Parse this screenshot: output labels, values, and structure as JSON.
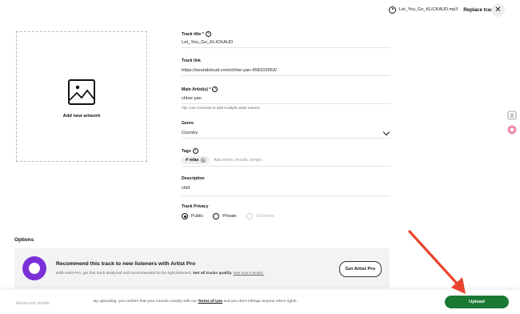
{
  "header": {
    "file_name": "Let_You_Go_KLICKAUD.mp3",
    "replace_label": "Replace track",
    "close_icon": "close-icon",
    "play_icon": "play-icon"
  },
  "artwork": {
    "label": "Add new artwork",
    "icon": "image-icon"
  },
  "form": {
    "title": {
      "label": "Track title *",
      "value": "Let_You_Go_KLICKAUD"
    },
    "link": {
      "label": "Track link",
      "value": "https://soundcloud.com/chloe-yan-458103953/"
    },
    "artist": {
      "label": "Main Artist(s) *",
      "value": "chloe yan",
      "tip": "Tip: Use commas to add multiple artist names."
    },
    "genre": {
      "label": "Genre",
      "value": "Country"
    },
    "tags": {
      "label": "Tags",
      "chip": "# relax",
      "placeholder": "Add styles, moods, tempo."
    },
    "description": {
      "label": "Description",
      "value": "chill"
    },
    "privacy": {
      "label": "Track Privacy",
      "options": [
        "Public",
        "Private",
        "Schedule"
      ],
      "selected": "Public"
    }
  },
  "options": {
    "title": "Options",
    "promo": {
      "title": "Recommend this track to new listeners with Artist Pro",
      "desc_start": "With Artist Pro, get this track analyzed and recommended to the right listeners.",
      "desc_bold": "Not all tracks qualify.",
      "desc_link": "See how it works.",
      "button": "Get Artist Pro"
    }
  },
  "footer": {
    "advanced": "Advanced details",
    "text_start": "By uploading, you confirm that your sounds comply with our",
    "terms": "Terms of Use",
    "text_end": "and you don't infringe anyone else's rights.",
    "upload": "Upload"
  },
  "colors": {
    "upload": "#1a7a33",
    "annotation_arrow": "#e8452e",
    "promo_logo": "#7b2fd6"
  }
}
